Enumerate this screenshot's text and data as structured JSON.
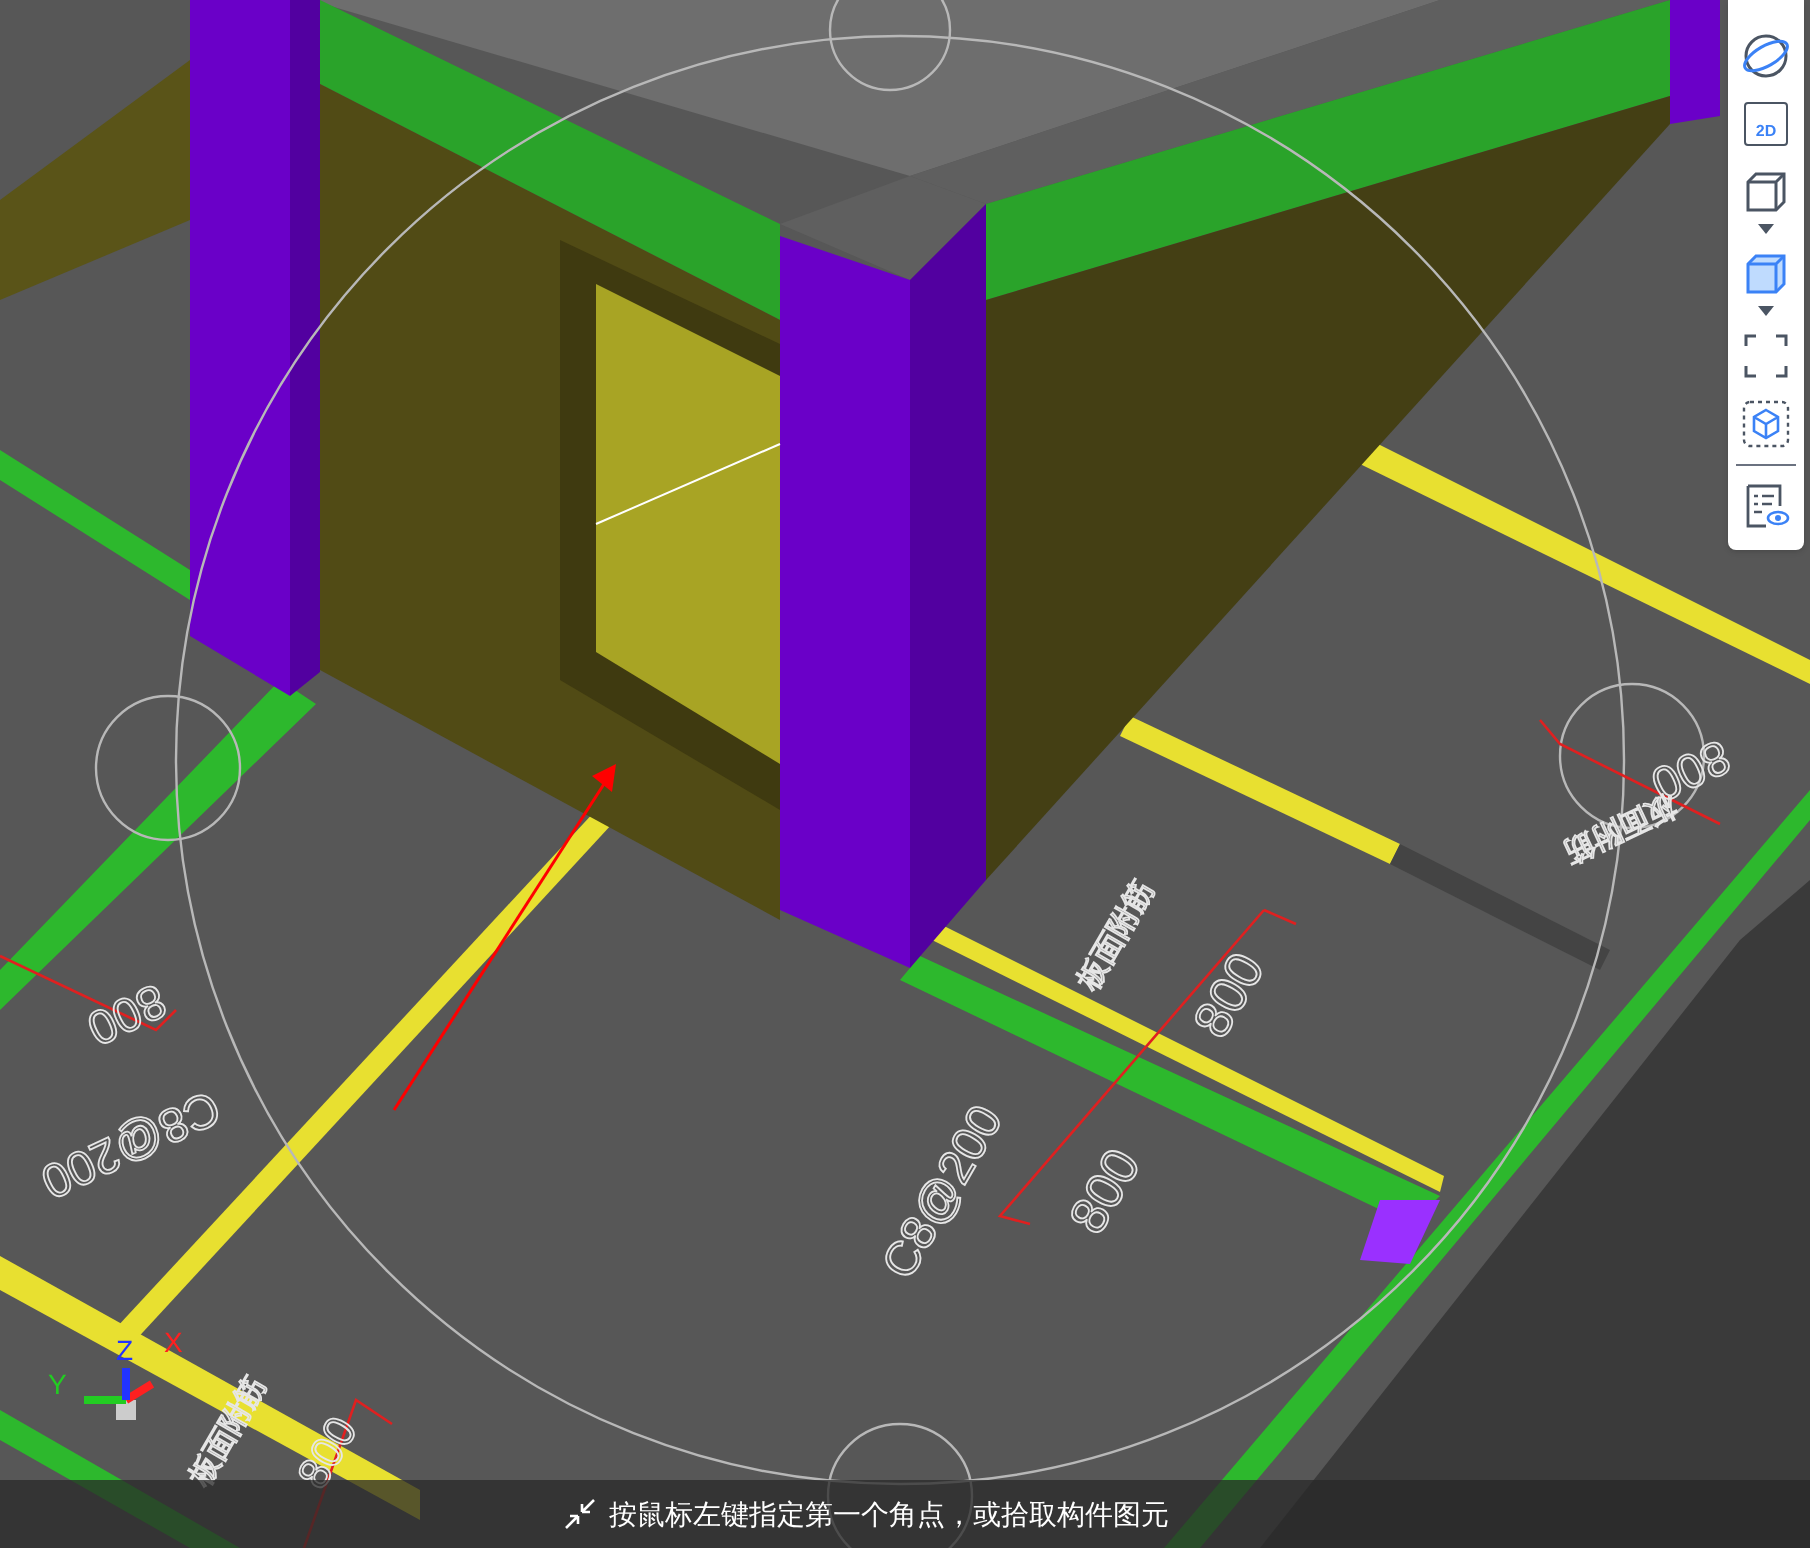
{
  "viewport": {
    "annotations": [
      {
        "text": "800"
      },
      {
        "text": "800"
      },
      {
        "text": "C8@200"
      },
      {
        "text": "板面附筋"
      },
      {
        "text": "800"
      },
      {
        "text": "C8@200"
      },
      {
        "text": "800"
      },
      {
        "text": "板面附筋"
      },
      {
        "text": "板面附筋"
      },
      {
        "text": "800"
      }
    ],
    "axes": [
      {
        "label": "X"
      },
      {
        "label": "Y"
      },
      {
        "label": "Z"
      }
    ]
  },
  "toolbar": {
    "buttons": [
      {
        "kind": "orbit"
      },
      {
        "kind": "view",
        "label": "2D"
      },
      {
        "kind": "wireframe",
        "dropdown": true
      },
      {
        "kind": "shaded",
        "dropdown": true
      },
      {
        "kind": "select"
      },
      {
        "kind": "box-select"
      },
      {
        "kind": "separator"
      },
      {
        "kind": "properties"
      }
    ]
  },
  "status_bar": {
    "prompt": "按鼠标左键指定第一个角点，或拾取构件图元"
  }
}
